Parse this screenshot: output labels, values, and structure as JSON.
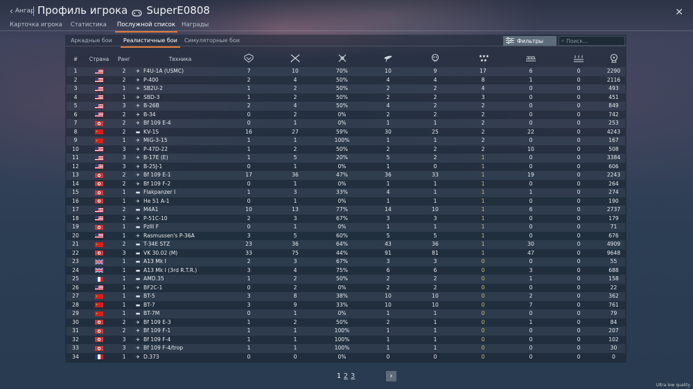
{
  "header": {
    "back_label": "Ангар",
    "title": "Профиль игрока",
    "player_name": "SuperE0808",
    "close_icon": "close-icon"
  },
  "tabs": [
    {
      "label": "Карточка игрока",
      "active": false
    },
    {
      "label": "Статистика",
      "active": false
    },
    {
      "label": "Послужной список",
      "active": true
    },
    {
      "label": "Награды",
      "active": false
    }
  ],
  "mode_tabs": [
    {
      "label": "Аркадные бои",
      "active": false
    },
    {
      "label": "Реалистичные бои",
      "active": true
    },
    {
      "label": "Симуляторные бои",
      "active": false
    }
  ],
  "filters_label": "Фильтры",
  "search_placeholder": "Поиск...",
  "columns": {
    "num": "#",
    "country": "Страна",
    "rank": "Ранг",
    "vehicle": "Техника"
  },
  "stat_icons": [
    "victories-icon",
    "missions-icon",
    "win-rate-icon",
    "air-kills-icon",
    "ground-kills-icon",
    "medals-icon",
    "naval-kills-icon",
    "missions-3-icon",
    "research-icon"
  ],
  "flag_colors": {
    "usa": "#b22234",
    "china": "#d42020",
    "germany": "#c93a3a",
    "uk": "#1f3f8f",
    "france": "#1f3f8f"
  },
  "rows": [
    {
      "n": "1",
      "c": "usa",
      "r": "2",
      "t": "air",
      "name": "F4U-1A (USMC)",
      "s": [
        "7",
        "10",
        "70%",
        "10",
        "9",
        "17",
        "6",
        "0",
        "2290"
      ]
    },
    {
      "n": "2",
      "c": "usa",
      "r": "2",
      "t": "air",
      "name": "P-400",
      "s": [
        "2",
        "4",
        "50%",
        "4",
        "4",
        "8",
        "1",
        "0",
        "2116"
      ]
    },
    {
      "n": "3",
      "c": "usa",
      "r": "1",
      "t": "air",
      "name": "SB2U-2",
      "s": [
        "1",
        "2",
        "50%",
        "2",
        "2",
        "4",
        "0",
        "0",
        "493"
      ]
    },
    {
      "n": "4",
      "c": "usa",
      "r": "1",
      "t": "air",
      "name": "SBD-3",
      "s": [
        "1",
        "2",
        "50%",
        "2",
        "2",
        "3",
        "0",
        "0",
        "451"
      ]
    },
    {
      "n": "5",
      "c": "usa",
      "r": "3",
      "t": "air",
      "name": "B-26B",
      "s": [
        "2",
        "4",
        "50%",
        "4",
        "2",
        "2",
        "0",
        "0",
        "849"
      ]
    },
    {
      "n": "6",
      "c": "usa",
      "r": "2",
      "t": "air",
      "name": "B-34",
      "s": [
        "0",
        "2",
        "0%",
        "2",
        "2",
        "2",
        "0",
        "0",
        "742"
      ]
    },
    {
      "n": "7",
      "c": "germany",
      "r": "2",
      "t": "air",
      "name": "Bf 109 E-4",
      "s": [
        "0",
        "1",
        "0%",
        "1",
        "1",
        "2",
        "0",
        "0",
        "253"
      ]
    },
    {
      "n": "8",
      "c": "china",
      "r": "2",
      "t": "tank",
      "name": "KV-1S",
      "s": [
        "16",
        "27",
        "59%",
        "30",
        "25",
        "2",
        "22",
        "0",
        "4243"
      ]
    },
    {
      "n": "9",
      "c": "china",
      "r": "1",
      "t": "air",
      "name": "MiG-3-15",
      "s": [
        "1",
        "1",
        "100%",
        "1",
        "1",
        "2",
        "0",
        "0",
        "167"
      ]
    },
    {
      "n": "10",
      "c": "usa",
      "r": "3",
      "t": "air",
      "name": "P-47D-22",
      "s": [
        "1",
        "2",
        "50%",
        "2",
        "2",
        "2",
        "10",
        "0",
        "508"
      ]
    },
    {
      "n": "11",
      "c": "usa",
      "r": "3",
      "t": "air",
      "name": "B-17E (E)",
      "s": [
        "1",
        "5",
        "20%",
        "5",
        "2",
        "1",
        "0",
        "0",
        "3384"
      ]
    },
    {
      "n": "12",
      "c": "usa",
      "r": "3",
      "t": "air",
      "name": "B-25J-1",
      "s": [
        "0",
        "1",
        "0%",
        "1",
        "0",
        "1",
        "0",
        "0",
        "606"
      ]
    },
    {
      "n": "13",
      "c": "germany",
      "r": "2",
      "t": "air",
      "name": "Bf 109 E-1",
      "s": [
        "17",
        "36",
        "47%",
        "36",
        "33",
        "1",
        "19",
        "0",
        "2243"
      ]
    },
    {
      "n": "14",
      "c": "germany",
      "r": "2",
      "t": "air",
      "name": "Bf 109 F-2",
      "s": [
        "0",
        "1",
        "0%",
        "1",
        "1",
        "1",
        "0",
        "0",
        "264"
      ]
    },
    {
      "n": "15",
      "c": "germany",
      "r": "1",
      "t": "tank",
      "name": "Flakpanzer I",
      "s": [
        "1",
        "3",
        "33%",
        "4",
        "1",
        "1",
        "1",
        "0",
        "274"
      ]
    },
    {
      "n": "16",
      "c": "germany",
      "r": "1",
      "t": "air",
      "name": "He 51 A-1",
      "s": [
        "0",
        "1",
        "0%",
        "1",
        "1",
        "1",
        "0",
        "0",
        "190"
      ]
    },
    {
      "n": "17",
      "c": "usa",
      "r": "2",
      "t": "tank",
      "name": "M4A1",
      "s": [
        "10",
        "13",
        "77%",
        "14",
        "10",
        "1",
        "6",
        "0",
        "2737"
      ]
    },
    {
      "n": "18",
      "c": "usa",
      "r": "2",
      "t": "air",
      "name": "P-51C-10",
      "s": [
        "2",
        "3",
        "67%",
        "3",
        "3",
        "1",
        "0",
        "0",
        "179"
      ]
    },
    {
      "n": "19",
      "c": "germany",
      "r": "1",
      "t": "tank",
      "name": "PzIII F",
      "s": [
        "0",
        "1",
        "0%",
        "1",
        "1",
        "1",
        "0",
        "0",
        "71"
      ]
    },
    {
      "n": "20",
      "c": "usa",
      "r": "1",
      "t": "air",
      "name": "Rasmussen's P-36A",
      "s": [
        "3",
        "5",
        "60%",
        "5",
        "5",
        "1",
        "0",
        "0",
        "676"
      ]
    },
    {
      "n": "21",
      "c": "china",
      "r": "2",
      "t": "tank",
      "name": "T-34E STZ",
      "s": [
        "23",
        "36",
        "64%",
        "43",
        "36",
        "1",
        "30",
        "0",
        "4909"
      ]
    },
    {
      "n": "22",
      "c": "germany",
      "r": "3",
      "t": "tank",
      "name": "VK 30.02 (M)",
      "s": [
        "33",
        "75",
        "44%",
        "91",
        "81",
        "1",
        "47",
        "0",
        "9648"
      ]
    },
    {
      "n": "23",
      "c": "uk",
      "r": "1",
      "t": "tank",
      "name": "A13 Mk I",
      "s": [
        "2",
        "3",
        "67%",
        "3",
        "3",
        "0",
        "0",
        "0",
        "55"
      ]
    },
    {
      "n": "24",
      "c": "uk",
      "r": "1",
      "t": "tank",
      "name": "A13 Mk I (3rd R.T.R.)",
      "s": [
        "3",
        "4",
        "75%",
        "6",
        "6",
        "0",
        "3",
        "0",
        "688"
      ]
    },
    {
      "n": "25",
      "c": "france",
      "r": "1",
      "t": "tank",
      "name": "AMD.35",
      "s": [
        "1",
        "2",
        "50%",
        "2",
        "2",
        "0",
        "1",
        "0",
        "158"
      ]
    },
    {
      "n": "26",
      "c": "usa",
      "r": "1",
      "t": "air",
      "name": "BF2C-1",
      "s": [
        "0",
        "2",
        "0%",
        "2",
        "2",
        "0",
        "0",
        "0",
        "22"
      ]
    },
    {
      "n": "27",
      "c": "china",
      "r": "1",
      "t": "tank",
      "name": "BT-5",
      "s": [
        "3",
        "8",
        "38%",
        "10",
        "10",
        "0",
        "2",
        "0",
        "362"
      ]
    },
    {
      "n": "28",
      "c": "china",
      "r": "1",
      "t": "tank",
      "name": "BT-7",
      "s": [
        "3",
        "9",
        "33%",
        "10",
        "10",
        "0",
        "7",
        "0",
        "761"
      ]
    },
    {
      "n": "29",
      "c": "china",
      "r": "1",
      "t": "tank",
      "name": "BT-7M",
      "s": [
        "0",
        "1",
        "0%",
        "1",
        "1",
        "0",
        "0",
        "0",
        "79"
      ]
    },
    {
      "n": "30",
      "c": "germany",
      "r": "2",
      "t": "air",
      "name": "Bf 109 E-3",
      "s": [
        "1",
        "2",
        "50%",
        "2",
        "1",
        "0",
        "1",
        "0",
        "84"
      ]
    },
    {
      "n": "31",
      "c": "germany",
      "r": "2",
      "t": "air",
      "name": "Bf 109 F-1",
      "s": [
        "1",
        "1",
        "100%",
        "1",
        "1",
        "0",
        "0",
        "0",
        "207"
      ]
    },
    {
      "n": "32",
      "c": "germany",
      "r": "3",
      "t": "air",
      "name": "Bf 109 F-4",
      "s": [
        "1",
        "1",
        "100%",
        "1",
        "1",
        "0",
        "0",
        "0",
        "102"
      ]
    },
    {
      "n": "33",
      "c": "germany",
      "r": "3",
      "t": "air",
      "name": "Bf 109 F-4/trop",
      "s": [
        "1",
        "1",
        "100%",
        "1",
        "1",
        "0",
        "0",
        "0",
        "30"
      ]
    },
    {
      "n": "34",
      "c": "france",
      "r": "1",
      "t": "air",
      "name": "D.373",
      "s": [
        "0",
        "0",
        "0%",
        "0",
        "0",
        "0",
        "0",
        "0",
        "0"
      ]
    }
  ],
  "pagination": {
    "pages": [
      "1",
      "2",
      "3"
    ],
    "current": "1"
  },
  "quality_label": "Ultra low quality"
}
